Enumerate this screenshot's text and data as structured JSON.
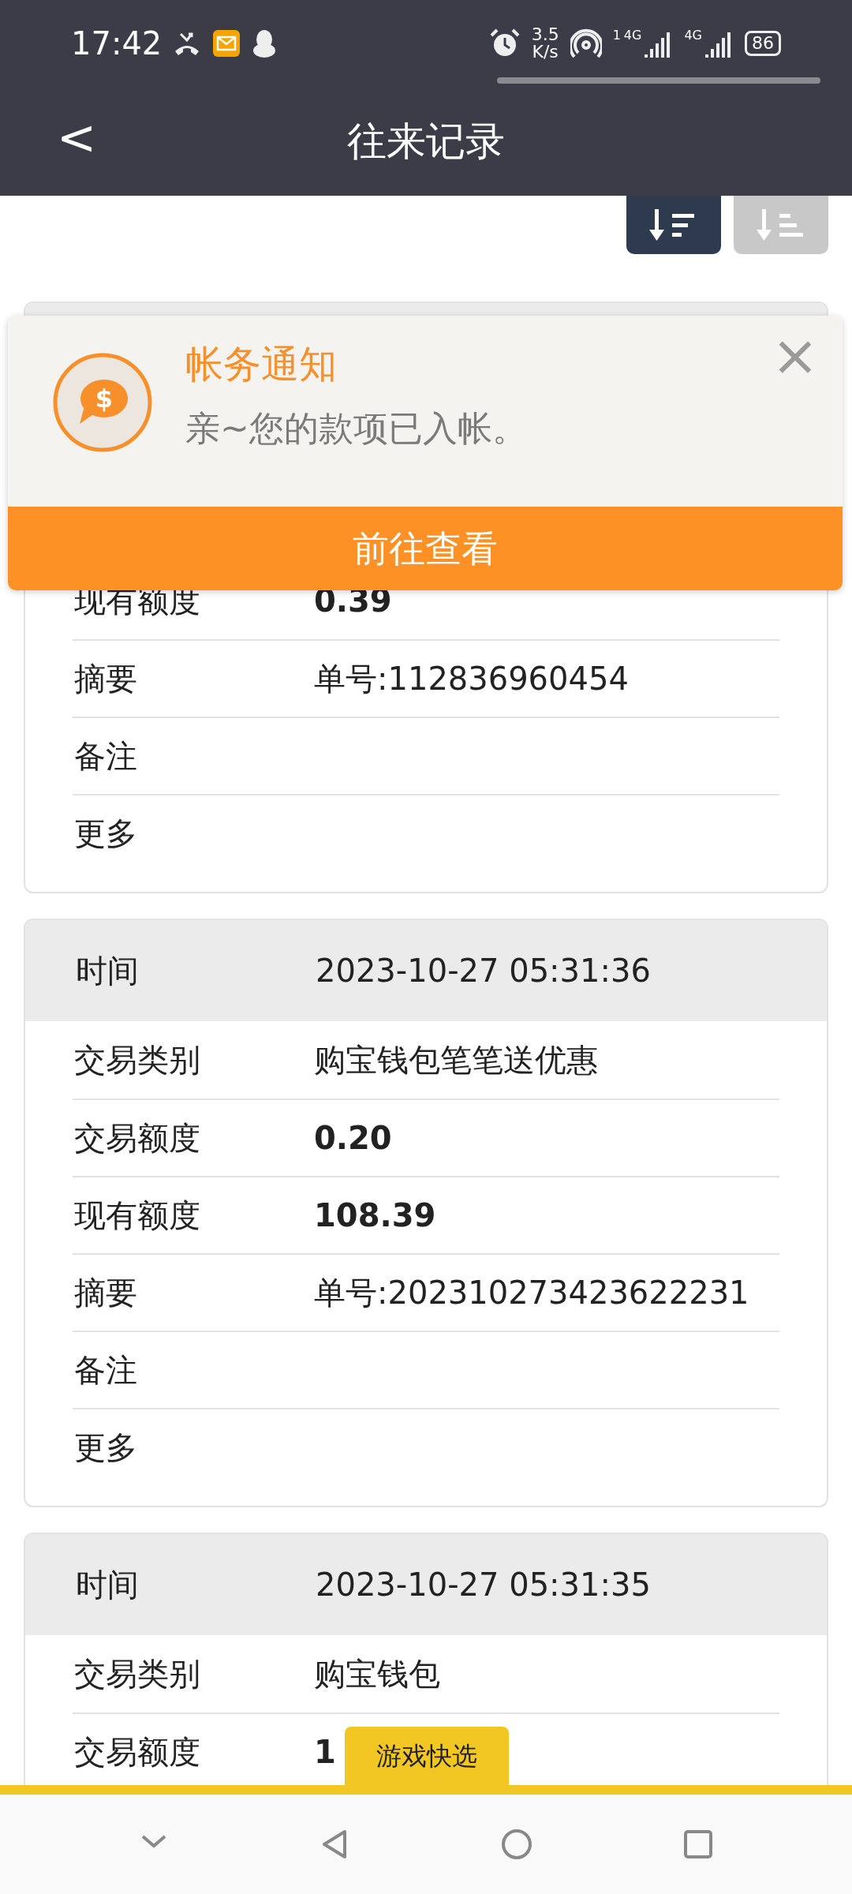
{
  "status_bar": {
    "time": "17:42",
    "speed_value": "3.5",
    "speed_unit": "K/s",
    "sim_1_slot": "1",
    "sim_1_type": "4G",
    "sim_2_type": "4G",
    "battery": "86"
  },
  "header": {
    "back": "<",
    "title": "往来记录"
  },
  "sort_buttons": [
    {
      "kind": "desc",
      "selected": true
    },
    {
      "kind": "asc",
      "selected": false
    }
  ],
  "records": [
    {
      "covered": true,
      "rows": [
        {
          "label": "现有额度",
          "value": "0.39",
          "bold": true
        },
        {
          "label": "摘要",
          "value": "单号:112836960454",
          "bold": false
        },
        {
          "label": "备注"
        },
        {
          "label": "更多"
        }
      ]
    },
    {
      "covered": false,
      "header": {
        "label": "时间",
        "value": "2023-10-27 05:31:36"
      },
      "rows": [
        {
          "label": "交易类别",
          "value": "购宝钱包笔笔送优惠",
          "bold": false
        },
        {
          "label": "交易额度",
          "value": "0.20",
          "bold": true
        },
        {
          "label": "现有额度",
          "value": "108.39",
          "bold": true
        },
        {
          "label": "摘要",
          "value": "单号:202310273423622231",
          "bold": false
        },
        {
          "label": "备注"
        },
        {
          "label": "更多"
        }
      ]
    },
    {
      "covered": false,
      "header": {
        "label": "时间",
        "value": "2023-10-27 05:31:35"
      },
      "rows": [
        {
          "label": "交易类别",
          "value": "购宝钱包",
          "bold": false
        },
        {
          "label": "交易额度",
          "value": "1",
          "bold": true
        }
      ]
    }
  ],
  "notification": {
    "icon_symbol": "$",
    "title": "帐务通知",
    "message": "亲~您的款项已入帐。",
    "close": "×",
    "action": "前往查看"
  },
  "floating_tab": {
    "label": "游戏快选"
  }
}
